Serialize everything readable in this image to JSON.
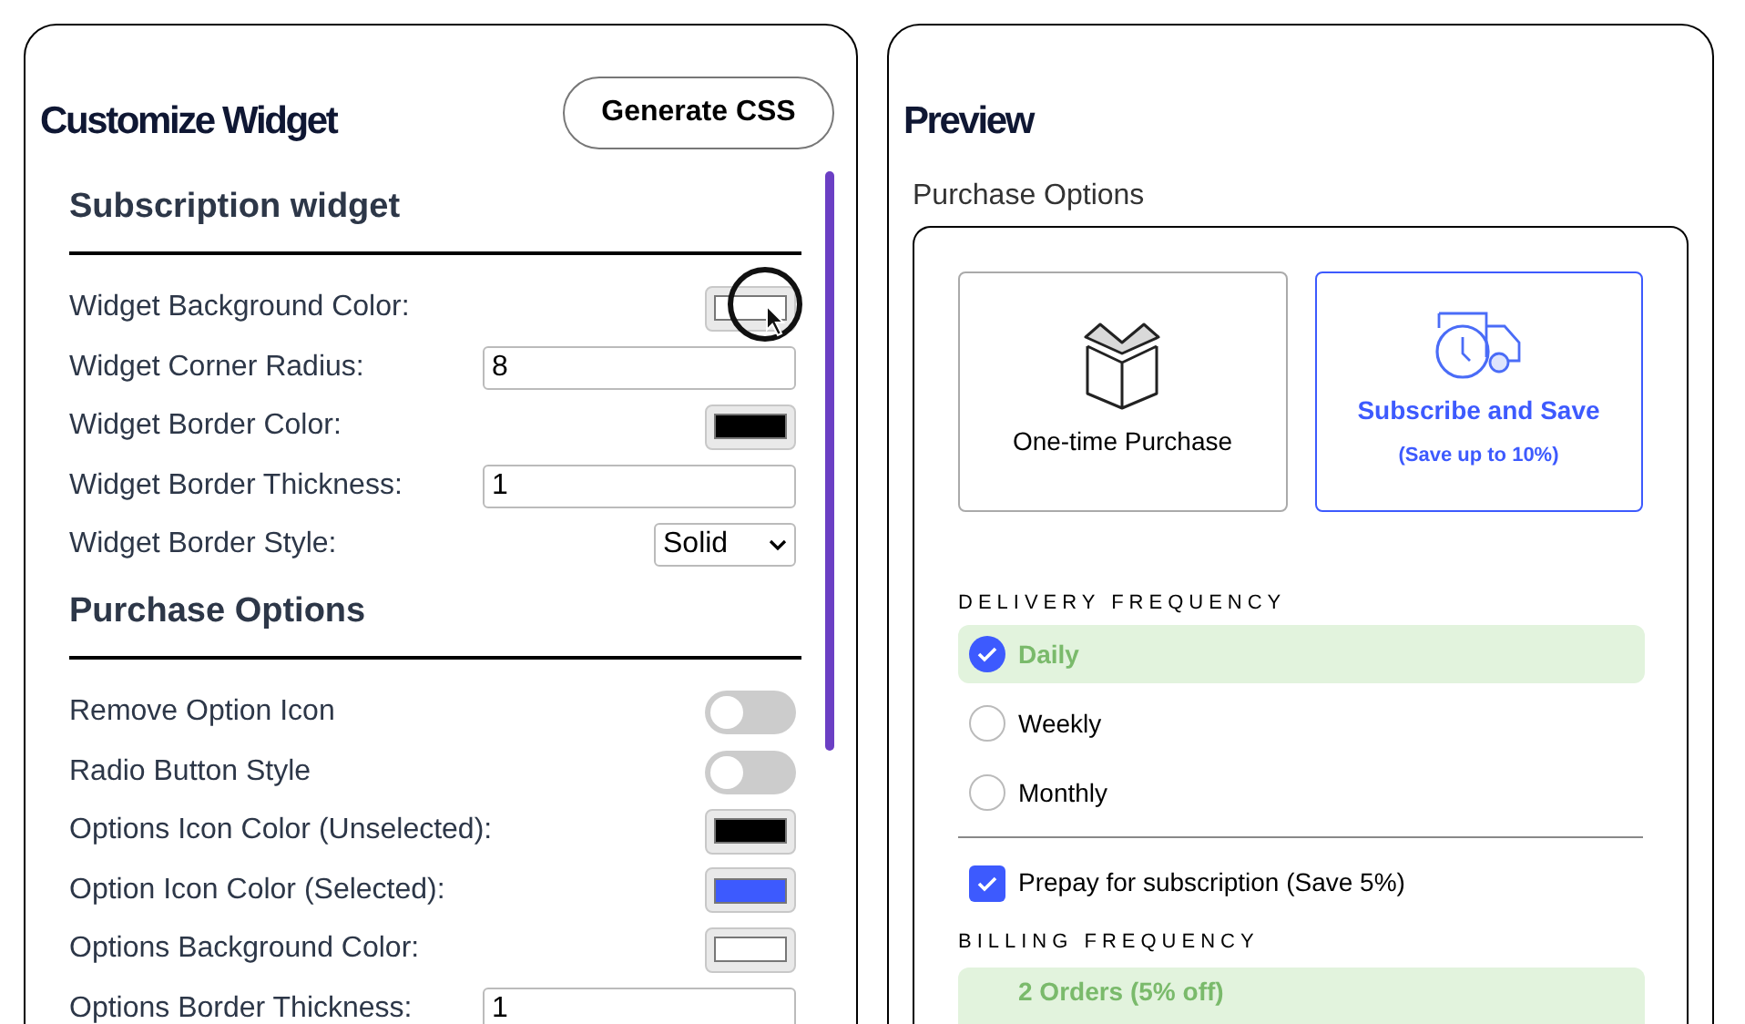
{
  "editor": {
    "title": "Customize Widget",
    "generate_button": "Generate CSS",
    "sections": [
      {
        "title": "Subscription widget",
        "rows": [
          {
            "kind": "color",
            "label": "Widget Background Color:",
            "color": "#ffffff"
          },
          {
            "kind": "number",
            "label": "Widget Corner Radius:",
            "value": "8"
          },
          {
            "kind": "color",
            "label": "Widget Border Color:",
            "color": "#000000"
          },
          {
            "kind": "number",
            "label": "Widget Border Thickness:",
            "value": "1"
          },
          {
            "kind": "select",
            "label": "Widget Border Style:",
            "value": "Solid"
          }
        ]
      },
      {
        "title": "Purchase Options",
        "rows": [
          {
            "kind": "toggle",
            "label": "Remove Option Icon",
            "on": false
          },
          {
            "kind": "toggle",
            "label": "Radio Button Style",
            "on": false
          },
          {
            "kind": "color",
            "label": "Options Icon Color (Unselected):",
            "color": "#000000"
          },
          {
            "kind": "color",
            "label": "Option Icon Color (Selected):",
            "color": "#3d5afe"
          },
          {
            "kind": "color",
            "label": "Options Background Color:",
            "color": "#ffffff"
          },
          {
            "kind": "number",
            "label": "Options Border Thickness:",
            "value": "1"
          }
        ]
      }
    ]
  },
  "preview": {
    "title": "Preview",
    "label": "Purchase Options",
    "purchase_options": [
      {
        "kind": "box",
        "label": "One-time Purchase",
        "selected": false
      },
      {
        "kind": "truck",
        "label": "Subscribe and Save",
        "sublabel": "(Save up to 10%)",
        "selected": true
      }
    ],
    "delivery": {
      "heading": "DELIVERY FREQUENCY",
      "options": [
        {
          "label": "Daily",
          "selected": true
        },
        {
          "label": "Weekly",
          "selected": false
        },
        {
          "label": "Monthly",
          "selected": false
        }
      ]
    },
    "prepay": {
      "label": "Prepay for subscription (Save 5%)",
      "checked": true
    },
    "billing": {
      "heading": "BILLING FREQUENCY",
      "options": [
        {
          "label": "2 Orders (5% off)",
          "selected": true
        }
      ]
    }
  }
}
